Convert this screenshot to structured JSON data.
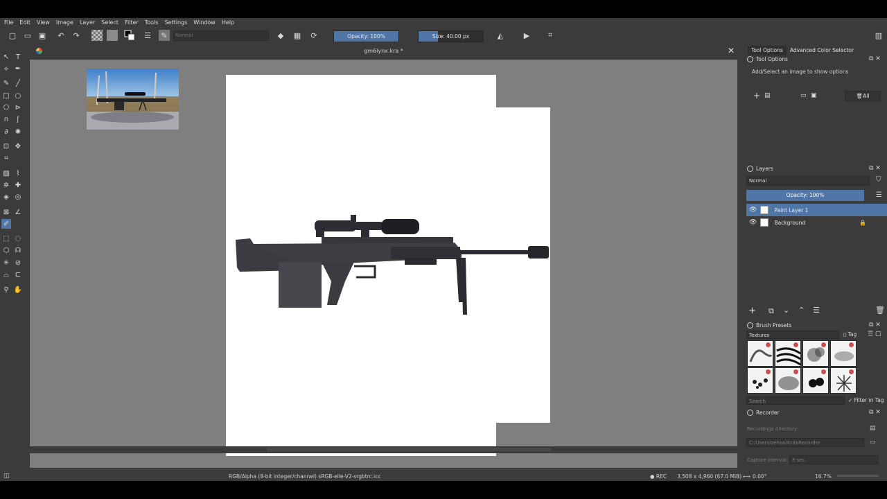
{
  "menu": [
    "File",
    "Edit",
    "View",
    "Image",
    "Layer",
    "Select",
    "Filter",
    "Tools",
    "Settings",
    "Window",
    "Help"
  ],
  "toolbar": {
    "blend_mode": "Normal",
    "opacity_label": "Opacity: 100%",
    "opacity_value": 1.0,
    "size_label": "Size: 40.00 px",
    "size_fill": 0.3
  },
  "document": {
    "title": "gm6lynx.kra *"
  },
  "docker": {
    "tabs": [
      "Tool Options",
      "Advanced Color Selector"
    ],
    "tool_options": {
      "title": "Tool Options",
      "message": "Add/Select an image to show options",
      "all_button": "All"
    },
    "layers": {
      "title": "Layers",
      "blend_mode": "Normal",
      "opacity_label": "Opacity:  100%",
      "items": [
        {
          "name": "Paint Layer 1",
          "selected": true
        },
        {
          "name": "Background",
          "selected": false
        }
      ]
    },
    "brush_presets": {
      "title": "Brush Presets",
      "tag": "Textures",
      "tag_button": "Tag",
      "search_placeholder": "Search",
      "filter_label": "Filter in Tag"
    },
    "recorder": {
      "title": "Recorder",
      "dir_label": "Recordings directory:",
      "dir_value": "C:/Users/zehao/KritaRecorder",
      "interval_label": "Capture interval:",
      "interval_value": "8 sec."
    }
  },
  "status": {
    "color_space": "RGB/Alpha (8-bit integer/channel)  sRGB-elle-V2-srgbtrc.icc",
    "rec": "● REC",
    "dimensions": "3,508 x 4,960 (67.0 MiB)",
    "rotation": "0.00°",
    "zoom": "16.7%"
  }
}
